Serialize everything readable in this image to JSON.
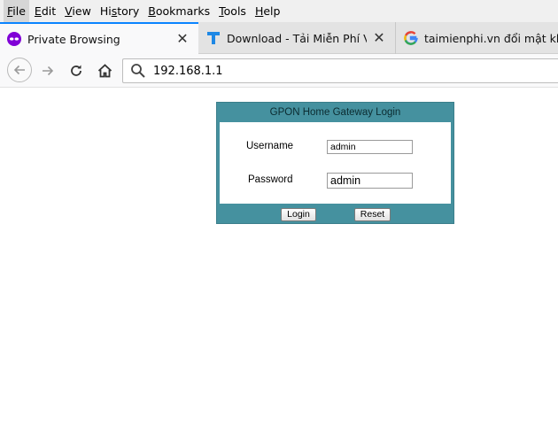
{
  "menu": {
    "items": [
      {
        "label": "File",
        "key": "F",
        "rest": "ile"
      },
      {
        "label": "Edit",
        "key": "E",
        "rest": "dit"
      },
      {
        "label": "View",
        "key": "V",
        "rest": "iew"
      },
      {
        "label": "History",
        "key": "H",
        "rest": "istory"
      },
      {
        "label": "Bookmarks",
        "key": "B",
        "rest": "ookmarks"
      },
      {
        "label": "Tools",
        "key": "T",
        "rest": "ools"
      },
      {
        "label": "Help",
        "key": "H",
        "rest": "elp"
      }
    ]
  },
  "tabs": [
    {
      "label": "Private Browsing",
      "icon": "private-mask-icon",
      "active": true
    },
    {
      "label": "Download - Tải Miễn Phí VN - Phần mềm",
      "icon": "taimienphi-t-icon",
      "active": false
    },
    {
      "label": "taimienphi.vn đổi mật khẩu",
      "icon": "google-g-icon",
      "active": false
    }
  ],
  "address": {
    "value": "192.168.1.1"
  },
  "login": {
    "title": "GPON Home Gateway Login",
    "username_label": "Username",
    "username_value": "admin",
    "password_label": "Password",
    "password_value": "admin",
    "login_button": "Login",
    "reset_button": "Reset"
  },
  "colors": {
    "panel": "#45919f",
    "tab_accent": "#0a84ff",
    "private_icon": "#8000d7",
    "t_icon": "#1e88e5"
  }
}
